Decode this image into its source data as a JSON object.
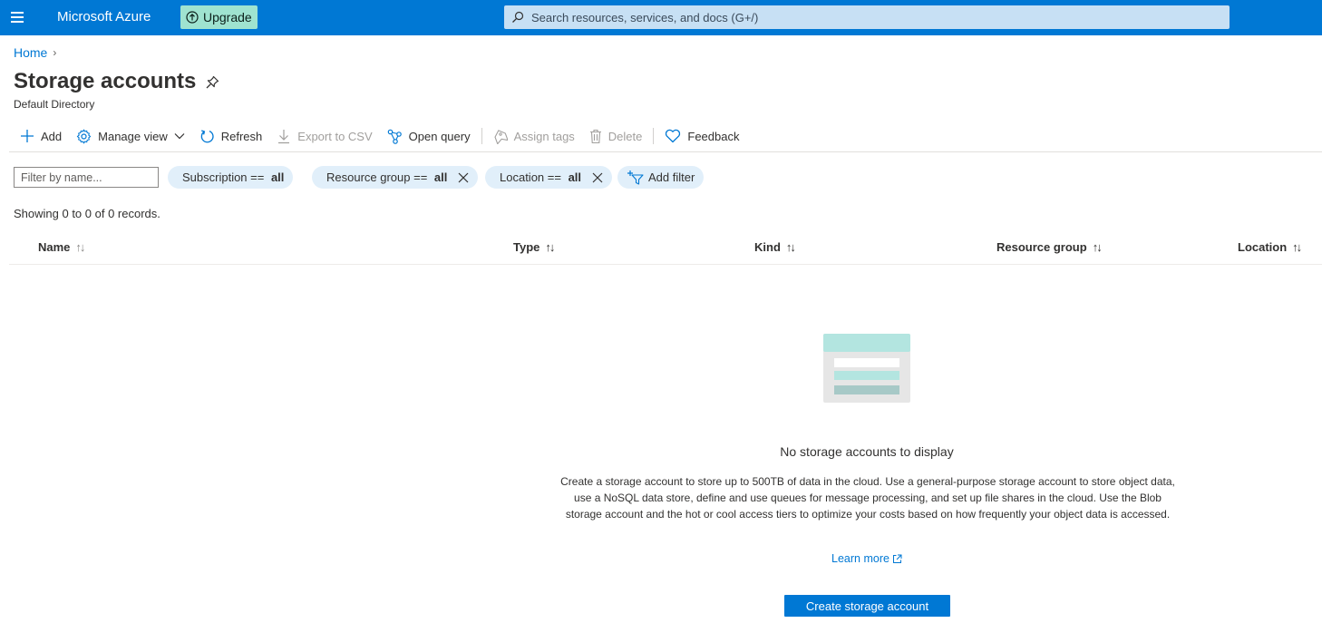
{
  "topbar": {
    "menu_icon": "hamburger-icon",
    "brand": "Microsoft Azure",
    "upgrade_label": "Upgrade",
    "upgrade_icon": "arrow-up-circle-icon",
    "search_placeholder": "Search resources, services, and docs (G+/)",
    "search_icon": "search-icon",
    "colors": {
      "bar": "#0078d4",
      "upgrade_bg": "#9fe3d0",
      "search_bg": "#c7e0f4"
    }
  },
  "breadcrumb": {
    "home": "Home",
    "separator": "›"
  },
  "page": {
    "title": "Storage accounts",
    "subtitle": "Default Directory",
    "pin_icon": "pin-icon"
  },
  "toolbar": {
    "items": [
      {
        "label": "Add",
        "icon": "plus-icon",
        "enabled": true
      },
      {
        "label": "Manage view",
        "icon": "gear-icon",
        "enabled": true
      },
      {
        "label": "Refresh",
        "icon": "refresh-icon",
        "enabled": true
      },
      {
        "label": "Export to CSV",
        "icon": "download-icon",
        "enabled": false
      },
      {
        "label": "Open query",
        "icon": "query-icon",
        "enabled": true
      },
      {
        "label": "Assign tags",
        "icon": "tag-icon",
        "enabled": false
      },
      {
        "label": "Delete",
        "icon": "trash-icon",
        "enabled": false
      },
      {
        "label": "Feedback",
        "icon": "heart-icon",
        "enabled": true
      }
    ]
  },
  "filters": {
    "name_placeholder": "Filter by name...",
    "subscription": {
      "prefix": "Subscription == ",
      "value": "all"
    },
    "resource_group": {
      "prefix": "Resource group == ",
      "value": "all"
    },
    "location": {
      "prefix": "Location == ",
      "value": "all"
    },
    "add_filter": "Add filter"
  },
  "records": "Showing 0 to 0 of 0 records.",
  "table": {
    "columns": [
      {
        "label": "Name",
        "sort": "↑↓"
      },
      {
        "label": "Type",
        "sort": "↑↓"
      },
      {
        "label": "Kind",
        "sort": "↑↓"
      },
      {
        "label": "Resource group",
        "sort": "↑↓"
      },
      {
        "label": "Location",
        "sort": "↑↓"
      }
    ],
    "rows": []
  },
  "empty_state": {
    "title": "No storage accounts to display",
    "description": "Create a storage account to store up to 500TB of data in the cloud. Use a general-purpose storage account to store object data, use a NoSQL data store, define and use queues for message processing, and set up file shares in the cloud. Use the Blob storage account and the hot or cool access tiers to optimize your costs based on how frequently your object data is accessed.",
    "learn_more": "Learn more",
    "create_button": "Create storage account"
  }
}
